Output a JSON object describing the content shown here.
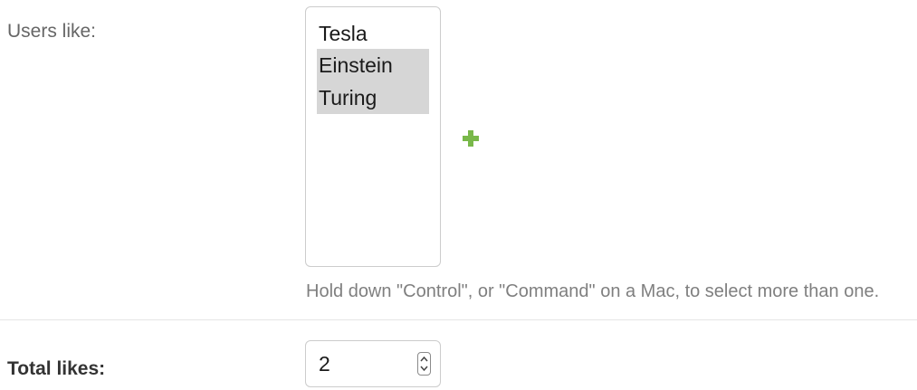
{
  "users_like": {
    "label": "Users like:",
    "options": [
      {
        "label": "Tesla",
        "selected": false
      },
      {
        "label": "Einstein",
        "selected": true
      },
      {
        "label": "Turing",
        "selected": true
      }
    ],
    "add_icon": "plus-icon",
    "help_text": "Hold down \"Control\", or \"Command\" on a Mac, to select more than one."
  },
  "total_likes": {
    "label": "Total likes:",
    "value": "2",
    "spinner_icon": "spinner-icon"
  },
  "colors": {
    "add_icon": "#79b84a",
    "selected_option": "#d6d6d6",
    "help_text": "#7f7f7f"
  }
}
